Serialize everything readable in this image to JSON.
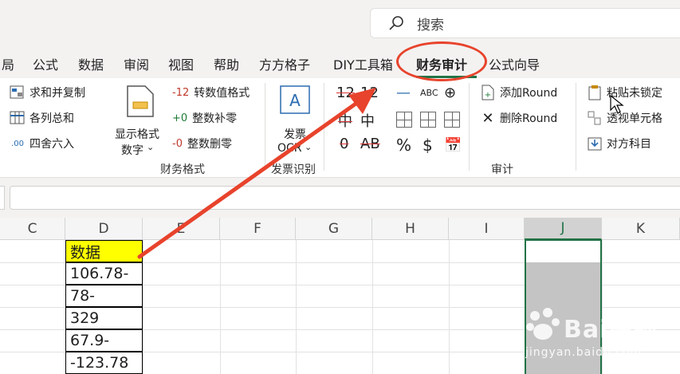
{
  "search": {
    "placeholder": "搜索"
  },
  "tabs": [
    {
      "label": "局"
    },
    {
      "label": "公式"
    },
    {
      "label": "数据"
    },
    {
      "label": "审阅"
    },
    {
      "label": "视图"
    },
    {
      "label": "帮助"
    },
    {
      "label": "方方格子"
    },
    {
      "label": "DIY工具箱"
    },
    {
      "label": "财务审计"
    },
    {
      "label": "公式向导"
    }
  ],
  "ribbon": {
    "sum_copy": "求和并复制",
    "col_sum": "各列总和",
    "round": "四舍六入",
    "show_format": "显示格式",
    "digits": "数字",
    "neg_prefix": "-12",
    "to_value_format": "转数值格式",
    "pos_prefix": "+0",
    "fill_zero": "整数补零",
    "neg0_prefix": "-0",
    "del_zero": "整数删零",
    "finance_group": "财务格式",
    "invoice": "发票",
    "ocr": "OCR",
    "invoice_group": "发票识别",
    "strike_12a": "12",
    "strike_12b": "12",
    "zhong_a": "中",
    "zhong_b": "中",
    "zero": "0",
    "ab": "AB",
    "minus": "—",
    "abc": "ABC",
    "percent": "%",
    "dollar": "$",
    "add_round": "添加Round",
    "del_round": "删除Round",
    "audit_group": "审计",
    "paste_unlocked": "粘贴未锁定",
    "pivot_cell": "透视单元格",
    "counter_account": "对方科目"
  },
  "sheet": {
    "columns": [
      "C",
      "D",
      "E",
      "F",
      "G",
      "H",
      "I",
      "J",
      "K"
    ],
    "d_cells": [
      "数据",
      "106.78-",
      "78-",
      "329",
      "67.9-",
      "-123.78"
    ]
  },
  "watermark": {
    "brand": "Bai经验",
    "url": "jingyan.baidu.com"
  },
  "colors": {
    "accent": "#217346",
    "annotation": "#e8432c",
    "highlight": "#ffff00"
  }
}
